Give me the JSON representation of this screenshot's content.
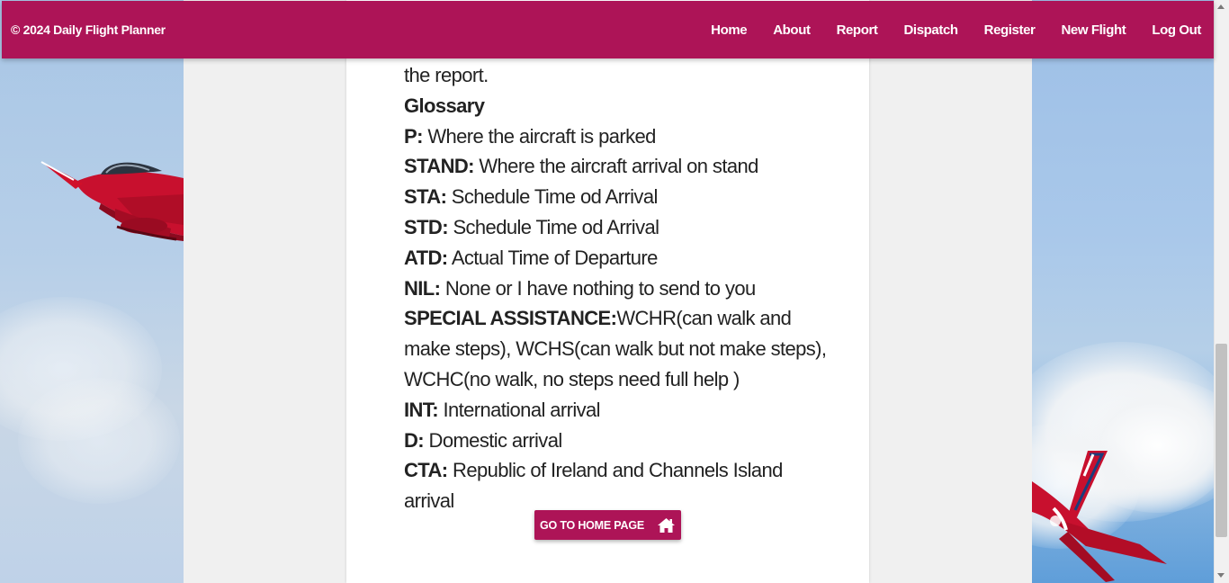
{
  "navbar": {
    "brand": "© 2024 Daily Flight Planner",
    "links": [
      "Home",
      "About",
      "Report",
      "Dispatch",
      "Register",
      "New Flight",
      "Log Out"
    ]
  },
  "content": {
    "intro_tail": "the report.",
    "glossary_heading": "Glossary",
    "glossary": [
      {
        "term": "P:",
        "definition": " Where the aircraft is parked"
      },
      {
        "term": "STAND:",
        "definition": " Where the aircraft arrival on stand"
      },
      {
        "term": "STA:",
        "definition": " Schedule Time od Arrival"
      },
      {
        "term": "STD:",
        "definition": " Schedule Time od Arrival"
      },
      {
        "term": "ATD:",
        "definition": " Actual Time of Departure"
      },
      {
        "term": "NIL:",
        "definition": " None or I have nothing to send to you"
      },
      {
        "term": "SPECIAL ASSISTANCE:",
        "definition": "WCHR(can walk and make steps), WCHS(can walk but not make steps), WCHC(no walk, no steps need full help )"
      },
      {
        "term": "INT:",
        "definition": " International arrival"
      },
      {
        "term": "D:",
        "definition": " Domestic arrival"
      },
      {
        "term": "CTA:",
        "definition": " Republic of Ireland and Channels Island arrival"
      }
    ]
  },
  "home_button": {
    "label": "Go to home page",
    "icon": "home-icon"
  },
  "colors": {
    "primary": "#ad1457",
    "page_background": "#f0f0f0",
    "card": "#ffffff",
    "jet_red": "#d0102a"
  }
}
